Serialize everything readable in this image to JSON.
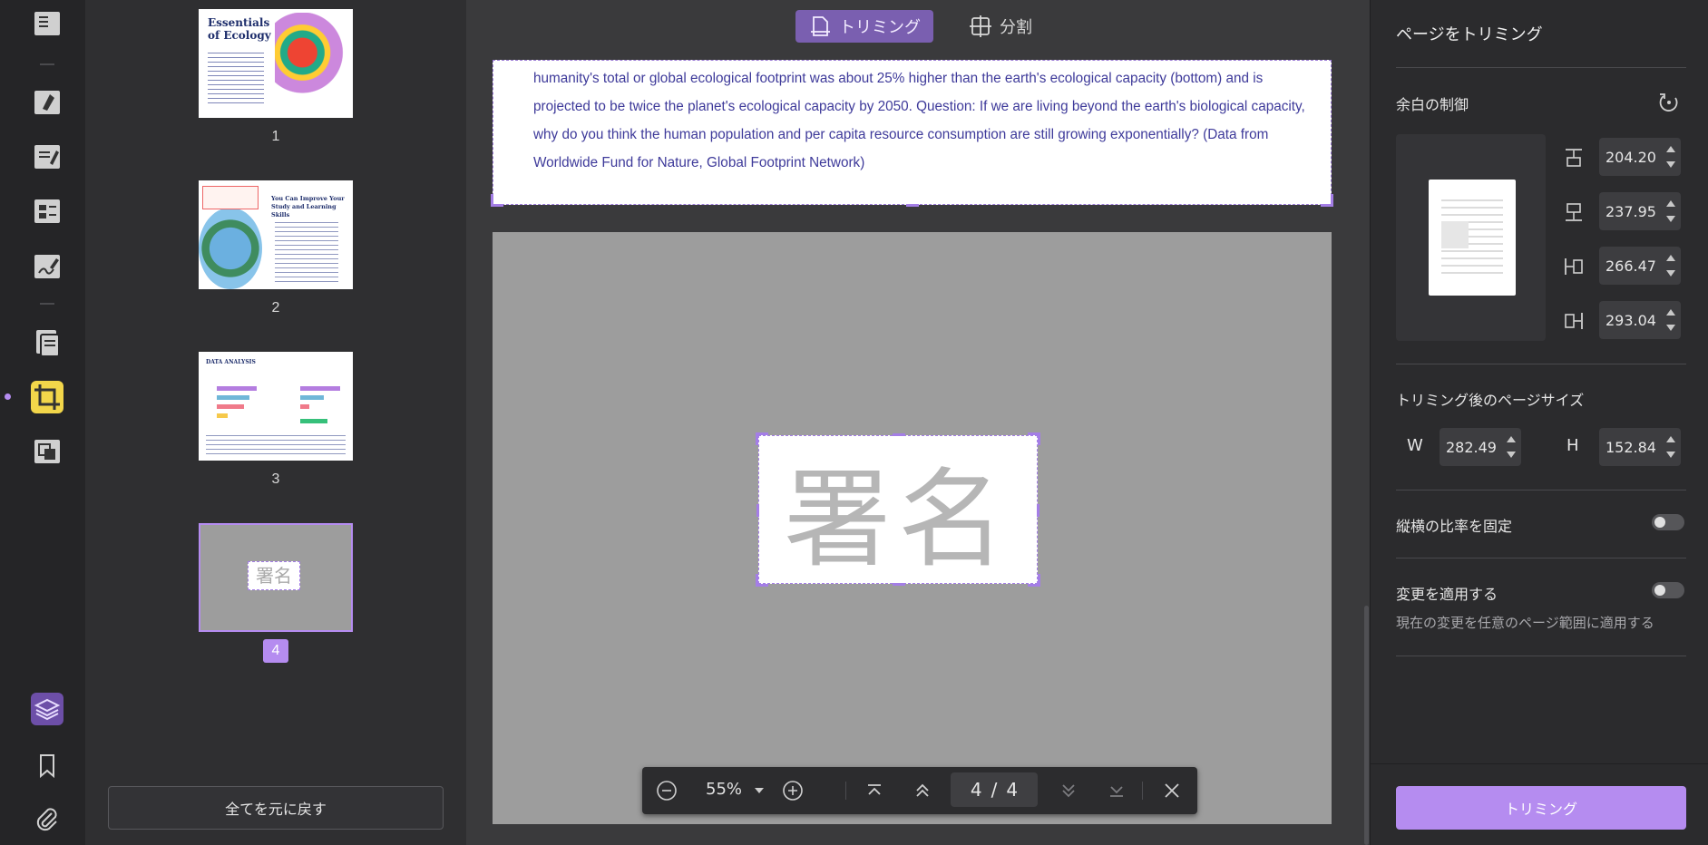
{
  "top_modes": {
    "trim_label": "トリミング",
    "split_label": "分割"
  },
  "thumbnails": {
    "pages": [
      {
        "number": "1",
        "title": "Essentials of Ecology"
      },
      {
        "number": "2",
        "title": "You Can Improve Your Study and Learning Skills"
      },
      {
        "number": "3",
        "title": "DATA ANALYSIS"
      },
      {
        "number": "4",
        "title": "署名"
      }
    ],
    "revert_all_label": "全てを元に戻す"
  },
  "document": {
    "top_page_text": "humanity's total or global ecological footprint was about 25% higher than the earth's ecological capacity (bottom) and is projected to be twice the planet's ecological capacity by 2050. Question: If we are living beyond the earth's biological capacity, why do you think the human population and per capita resource consumption are still growing exponentially? (Data from Worldwide Fund for Nature, Global Footprint Network)",
    "signature_text": "署名"
  },
  "zoombar": {
    "zoom": "55%",
    "current_page": "4",
    "separator": "/",
    "total_pages": "4"
  },
  "panel": {
    "title": "ページをトリミング",
    "margin_section": "余白の制御",
    "margins": {
      "top": "204.20",
      "bottom": "237.95",
      "left": "266.47",
      "right": "293.04"
    },
    "size_section": "トリミング後のページサイズ",
    "width_label": "W",
    "width": "282.49",
    "height_label": "H",
    "height": "152.84",
    "lock_ratio_label": "縦横の比率を固定",
    "apply_changes_label": "変更を適用する",
    "apply_changes_desc": "現在の変更を任意のページ範囲に適用する",
    "trim_button": "トリミング"
  },
  "colors": {
    "accent": "#b58cf0",
    "text_blue": "#3e3a9a",
    "active_tool": "#f2d64a"
  }
}
